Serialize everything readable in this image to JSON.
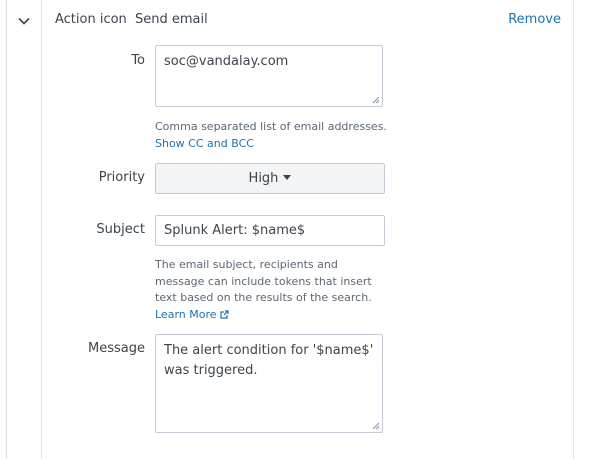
{
  "header": {
    "action_label": "Action icon",
    "action_value": "Send email",
    "remove_label": "Remove"
  },
  "fields": {
    "to": {
      "label": "To",
      "value": "soc@vandalay.com",
      "help": "Comma separated list of email addresses.",
      "cc_bcc_link": "Show CC and BCC"
    },
    "priority": {
      "label": "Priority",
      "value": "High"
    },
    "subject": {
      "label": "Subject",
      "value": "Splunk Alert: $name$",
      "help_line1": "The email subject, recipients and",
      "help_line2": "message can include tokens that insert",
      "help_line3": "text based on the results of the search.",
      "learn_more": "Learn More"
    },
    "message": {
      "label": "Message",
      "value_line1": "The alert condition for '$name$'",
      "value_line2": "was triggered."
    }
  },
  "icons": {
    "collapse": "chevron-down-icon",
    "external_link": "external-link-icon",
    "resize": "resize-grip-icon"
  },
  "colors": {
    "link": "#1a74ab",
    "border": "#c3cbd4",
    "text": "#3c444d"
  }
}
